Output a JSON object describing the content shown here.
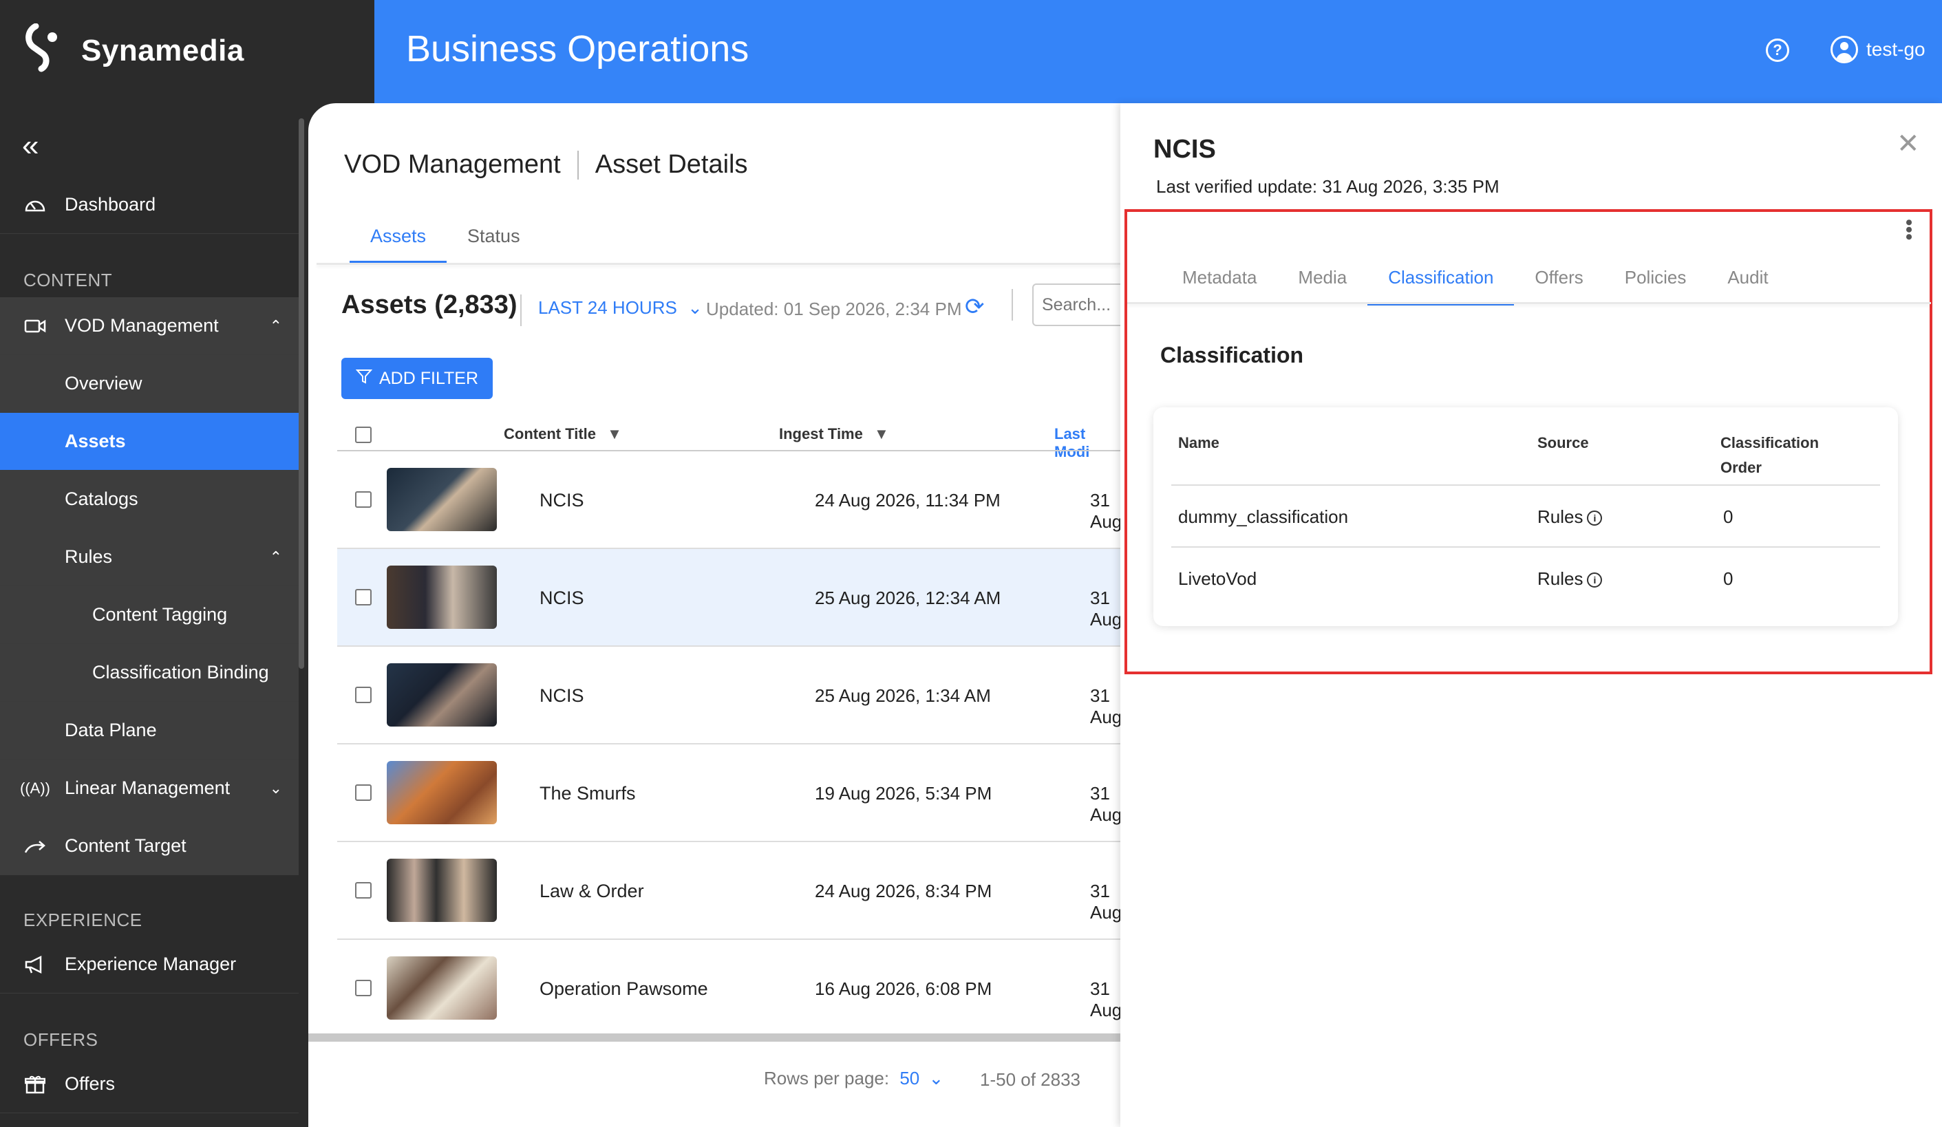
{
  "brand": {
    "name": "Synamedia"
  },
  "header": {
    "title": "Business Operations",
    "user": "test-go",
    "help_icon": "help-circle-icon"
  },
  "sidebar": {
    "collapse_icon": "double-chevron-left-icon",
    "dashboard": "Dashboard",
    "section_content": "CONTENT",
    "vod_management": "VOD Management",
    "overview": "Overview",
    "assets": "Assets",
    "catalogs": "Catalogs",
    "rules": "Rules",
    "content_tagging": "Content Tagging",
    "classification_binding": "Classification Binding",
    "data_plane": "Data Plane",
    "linear_management": "Linear Management",
    "content_target": "Content Target",
    "section_experience": "EXPERIENCE",
    "experience_manager": "Experience Manager",
    "section_offers": "OFFERS",
    "offers": "Offers"
  },
  "main": {
    "breadcrumb": [
      "VOD Management",
      "Asset Details"
    ],
    "tabs": [
      {
        "label": "Assets",
        "active": true
      },
      {
        "label": "Status",
        "active": false
      }
    ],
    "assets_title": "Assets (2,833)",
    "time_range": "LAST 24 HOURS",
    "updated": "Updated: 01 Sep 2026, 2:34 PM",
    "search_placeholder": "Search...",
    "add_filter": "ADD FILTER",
    "columns": {
      "title": "Content Title",
      "ingest": "Ingest Time",
      "modified": "Last Modi"
    },
    "rows": [
      {
        "title": "NCIS",
        "ingest": "24 Aug 2026, 11:34 PM",
        "modified": "31 Aug",
        "highlighted": false
      },
      {
        "title": "NCIS",
        "ingest": "25 Aug 2026, 12:34 AM",
        "modified": "31 Aug",
        "highlighted": true
      },
      {
        "title": "NCIS",
        "ingest": "25 Aug 2026, 1:34 AM",
        "modified": "31 Aug",
        "highlighted": false
      },
      {
        "title": "The Smurfs",
        "ingest": "19 Aug 2026, 5:34 PM",
        "modified": "31 Aug",
        "highlighted": false
      },
      {
        "title": "Law & Order",
        "ingest": "24 Aug 2026, 8:34 PM",
        "modified": "31 Aug",
        "highlighted": false
      },
      {
        "title": "Operation Pawsome",
        "ingest": "16 Aug 2026, 6:08 PM",
        "modified": "31 Aug",
        "highlighted": false
      }
    ],
    "pagination": {
      "rows_label": "Rows per page:",
      "rows_value": "50",
      "range": "1-50 of 2833"
    }
  },
  "panel": {
    "title": "NCIS",
    "subtitle": "Last verified update: 31 Aug 2026, 3:35 PM",
    "tabs": [
      "Metadata",
      "Media",
      "Classification",
      "Offers",
      "Policies",
      "Audit"
    ],
    "active_tab": "Classification",
    "section_title": "Classification",
    "table": {
      "headers": {
        "name": "Name",
        "source": "Source",
        "order_1": "Classification",
        "order_2": "Order"
      },
      "rows": [
        {
          "name": "dummy_classification",
          "source": "Rules",
          "order": "0"
        },
        {
          "name": "LivetoVod",
          "source": "Rules",
          "order": "0"
        }
      ]
    }
  },
  "colors": {
    "accent": "#2f7cf6",
    "header": "#3584f8",
    "sidebar": "#2b2b2b",
    "highlight_box": "#e53030"
  }
}
